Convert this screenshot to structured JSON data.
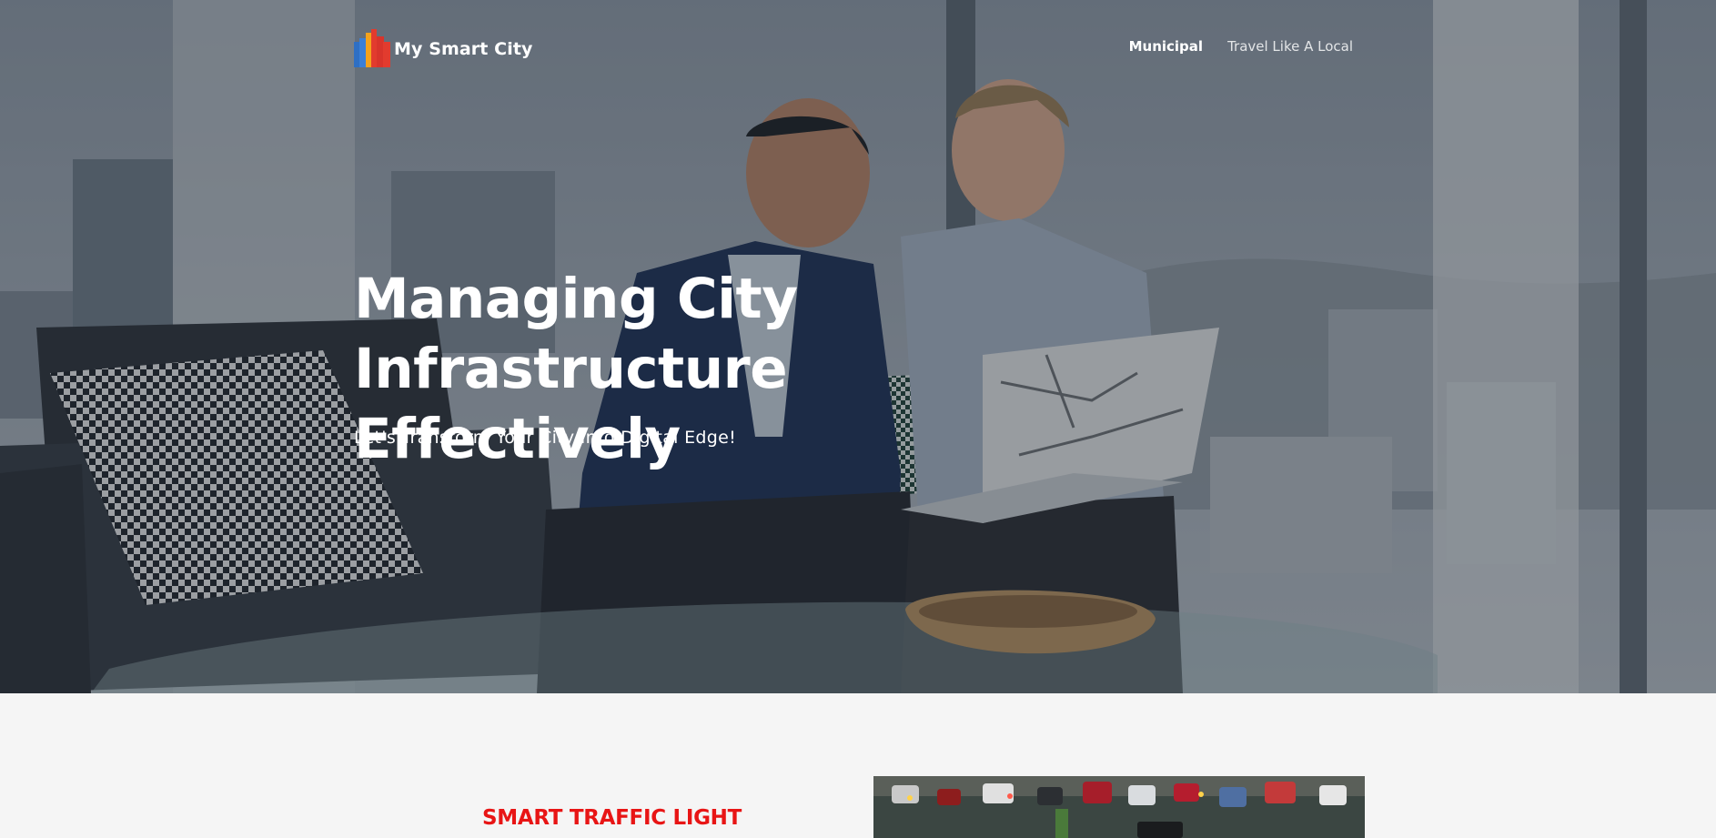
{
  "navbar": {
    "brand_name": "My Smart City",
    "links": [
      {
        "label": "Municipal",
        "active": true
      },
      {
        "label": "Travel Like A Local",
        "active": false
      }
    ]
  },
  "hero": {
    "title_line1": "Managing City Infrastructure",
    "title_line2": "Effectively",
    "subtitle": "Let's Transform Your City Into Digital Edge!"
  },
  "feature": {
    "title": "SMART TRAFFIC LIGHT"
  },
  "colors": {
    "accent_red": "#e81515",
    "logo_blue": "#2e6fc4",
    "logo_red": "#e23b2e",
    "logo_orange": "#f4a21c",
    "text_light": "#ffffff",
    "section_bg": "#f5f5f5"
  },
  "icons": {
    "brand_logo": "city-skyline-logo-icon"
  }
}
